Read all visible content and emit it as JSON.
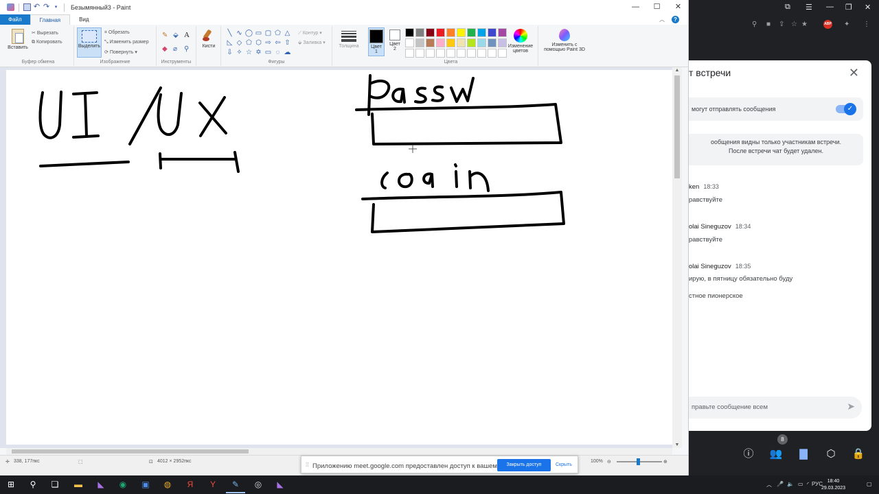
{
  "paint": {
    "title": "Безымянный3 - Paint",
    "tabs": {
      "file": "Файл",
      "home": "Главная",
      "view": "Вид"
    },
    "ribbon": {
      "clipboard": {
        "paste": "Вставить",
        "cut": "Вырезать",
        "copy": "Копировать",
        "label": "Буфер обмена"
      },
      "image": {
        "select": "Выделить",
        "crop": "Обрезать",
        "resize": "Изменить размер",
        "rotate": "Повернуть",
        "label": "Изображение"
      },
      "tools": {
        "label": "Инструменты"
      },
      "brushes": {
        "label": "Кисти"
      },
      "shapes": {
        "outline": "Контур",
        "fill": "Заливка",
        "label": "Фигуры"
      },
      "size": {
        "label": "Толщина"
      },
      "color1": {
        "label": "Цвет",
        "num": "1"
      },
      "color2": {
        "label": "Цвет",
        "num": "2"
      },
      "colors": {
        "label": "Цвета"
      },
      "edit_colors": {
        "line1": "Изменение",
        "line2": "цветов"
      },
      "paint3d": {
        "line1": "Изменить с",
        "line2": "помощью Paint 3D"
      }
    },
    "palette": [
      "#000000",
      "#7f7f7f",
      "#880015",
      "#ed1c24",
      "#ff7f27",
      "#fff200",
      "#22b14c",
      "#00a2e8",
      "#3f48cc",
      "#a349a4",
      "#ffffff",
      "#c3c3c3",
      "#b97a57",
      "#ffaec9",
      "#ffc90e",
      "#efe4b0",
      "#b5e61d",
      "#99d9ea",
      "#7092be",
      "#c8bfe7",
      "#ffffff",
      "#ffffff",
      "#ffffff",
      "#ffffff",
      "#ffffff",
      "#ffffff",
      "#ffffff",
      "#ffffff",
      "#ffffff",
      "#ffffff"
    ],
    "color1": "#000000",
    "color2": "#ffffff",
    "status": {
      "position": "338, 177пкс",
      "canvas_size": "4012 × 2952пкс",
      "zoom": "100%"
    }
  },
  "share_banner": {
    "message": "Приложению meet.google.com предоставлен доступ к вашему экрану.",
    "stop_label": "Закрыть доступ",
    "hide_label": "Скрыть"
  },
  "meet": {
    "chat": {
      "header": "т встречи",
      "toggle_label": "могут отправлять сообщения",
      "info_line1": "ообщения видны только участникам встречи.",
      "info_line2": "После встречи чат будет удален.",
      "messages": [
        {
          "who": "ken",
          "time": "18:33",
          "text": "равствуйте"
        },
        {
          "who": "olai Sineguzov",
          "time": "18:34",
          "text": "равствуйте"
        },
        {
          "who": "olai Sineguzov",
          "time": "18:35",
          "text": "ирую, в пятницу обязательно буду"
        },
        {
          "who": "",
          "time": "",
          "text": "стное пионерское"
        }
      ],
      "compose_placeholder": "правьте сообщение всем"
    },
    "participants_count": "8"
  },
  "taskbar": {
    "lang": "РУС",
    "time": "18:40",
    "date": "29.03.2023"
  }
}
